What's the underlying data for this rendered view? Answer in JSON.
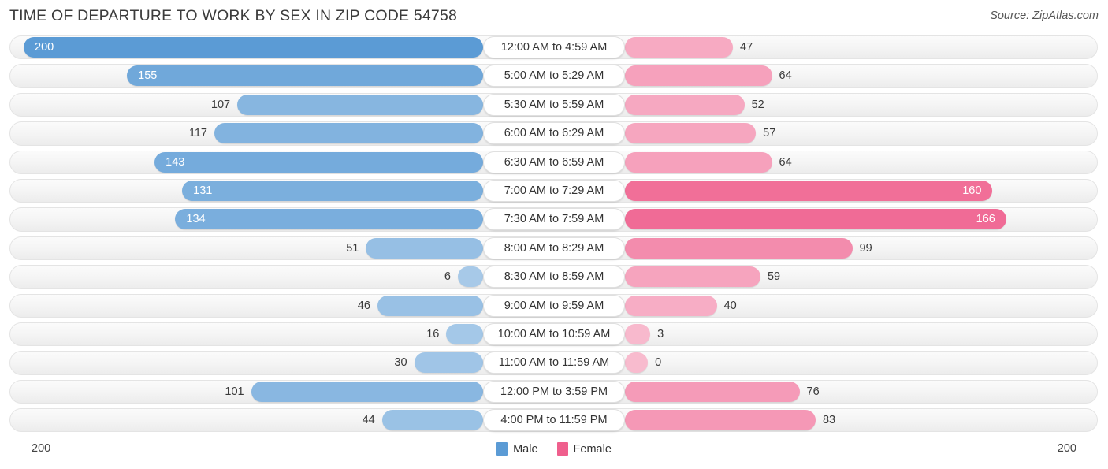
{
  "header": {
    "title": "TIME OF DEPARTURE TO WORK BY SEX IN ZIP CODE 54758",
    "source": "Source: ZipAtlas.com"
  },
  "legend": {
    "male_label": "Male",
    "female_label": "Female",
    "male_color": "#5b9bd5",
    "female_color": "#ef5f8d"
  },
  "axis": {
    "left_tick": "200",
    "right_tick": "200",
    "max": 200
  },
  "chart_data": {
    "type": "bar",
    "subtype": "diverging-bidirectional",
    "title": "TIME OF DEPARTURE TO WORK BY SEX IN ZIP CODE 54758",
    "xlabel": "",
    "ylabel": "",
    "xlim": [
      200,
      200
    ],
    "grid": false,
    "legend_position": "bottom-center",
    "categories": [
      "12:00 AM to 4:59 AM",
      "5:00 AM to 5:29 AM",
      "5:30 AM to 5:59 AM",
      "6:00 AM to 6:29 AM",
      "6:30 AM to 6:59 AM",
      "7:00 AM to 7:29 AM",
      "7:30 AM to 7:59 AM",
      "8:00 AM to 8:29 AM",
      "8:30 AM to 8:59 AM",
      "9:00 AM to 9:59 AM",
      "10:00 AM to 10:59 AM",
      "11:00 AM to 11:59 AM",
      "12:00 PM to 3:59 PM",
      "4:00 PM to 11:59 PM"
    ],
    "series": [
      {
        "name": "Male",
        "color": "#5b9bd5",
        "values": [
          200,
          155,
          107,
          117,
          143,
          131,
          134,
          51,
          6,
          46,
          16,
          30,
          101,
          44
        ]
      },
      {
        "name": "Female",
        "color": "#ef5f8d",
        "values": [
          47,
          64,
          52,
          57,
          64,
          160,
          166,
          99,
          59,
          40,
          3,
          0,
          76,
          83
        ]
      }
    ]
  },
  "rows": [
    {
      "category": "12:00 AM to 4:59 AM",
      "male": "200",
      "female": "47",
      "male_pct": 100.0,
      "female_pct": 23.5,
      "male_inside": true,
      "female_inside": false,
      "male_shade": 1.0,
      "female_shade": 0.33
    },
    {
      "category": "5:00 AM to 5:29 AM",
      "male": "155",
      "female": "64",
      "male_pct": 77.5,
      "female_pct": 32.0,
      "male_inside": true,
      "female_inside": false,
      "male_shade": 0.82,
      "female_shade": 0.41
    },
    {
      "category": "5:30 AM to 5:59 AM",
      "male": "107",
      "female": "52",
      "male_pct": 53.5,
      "female_pct": 26.0,
      "male_inside": false,
      "female_inside": false,
      "male_shade": 0.62,
      "female_shade": 0.35
    },
    {
      "category": "6:00 AM to 6:29 AM",
      "male": "117",
      "female": "57",
      "male_pct": 58.5,
      "female_pct": 28.5,
      "male_inside": false,
      "female_inside": false,
      "male_shade": 0.66,
      "female_shade": 0.37
    },
    {
      "category": "6:30 AM to 6:59 AM",
      "male": "143",
      "female": "64",
      "male_pct": 71.5,
      "female_pct": 32.0,
      "male_inside": true,
      "female_inside": false,
      "male_shade": 0.77,
      "female_shade": 0.41
    },
    {
      "category": "7:00 AM to 7:29 AM",
      "male": "131",
      "female": "160",
      "male_pct": 65.5,
      "female_pct": 80.0,
      "male_inside": true,
      "female_inside": true,
      "male_shade": 0.72,
      "female_shade": 0.86
    },
    {
      "category": "7:30 AM to 7:59 AM",
      "male": "134",
      "female": "166",
      "male_pct": 67.0,
      "female_pct": 83.0,
      "male_inside": true,
      "female_inside": true,
      "male_shade": 0.73,
      "female_shade": 0.89
    },
    {
      "category": "8:00 AM to 8:29 AM",
      "male": "51",
      "female": "99",
      "male_pct": 25.5,
      "female_pct": 49.5,
      "male_inside": false,
      "female_inside": false,
      "male_shade": 0.49,
      "female_shade": 0.6
    },
    {
      "category": "8:30 AM to 8:59 AM",
      "male": "6",
      "female": "59",
      "male_pct": 5.5,
      "female_pct": 29.5,
      "male_inside": false,
      "female_inside": false,
      "male_shade": 0.34,
      "female_shade": 0.38
    },
    {
      "category": "9:00 AM to 9:59 AM",
      "male": "46",
      "female": "40",
      "male_pct": 23.0,
      "female_pct": 20.0,
      "male_inside": false,
      "female_inside": false,
      "male_shade": 0.46,
      "female_shade": 0.3
    },
    {
      "category": "10:00 AM to 10:59 AM",
      "male": "16",
      "female": "3",
      "male_pct": 8.0,
      "female_pct": 5.5,
      "male_inside": false,
      "female_inside": false,
      "male_shade": 0.36,
      "female_shade": 0.2
    },
    {
      "category": "11:00 AM to 11:59 AM",
      "male": "30",
      "female": "0",
      "male_pct": 15.0,
      "female_pct": 5.0,
      "male_inside": false,
      "female_inside": false,
      "male_shade": 0.4,
      "female_shade": 0.18
    },
    {
      "category": "12:00 PM to 3:59 PM",
      "male": "101",
      "female": "76",
      "male_pct": 50.5,
      "female_pct": 38.0,
      "male_inside": false,
      "female_inside": false,
      "male_shade": 0.6,
      "female_shade": 0.46
    },
    {
      "category": "4:00 PM to 11:59 PM",
      "male": "44",
      "female": "83",
      "male_pct": 22.0,
      "female_pct": 41.5,
      "male_inside": false,
      "female_inside": false,
      "male_shade": 0.45,
      "female_shade": 0.49
    }
  ]
}
